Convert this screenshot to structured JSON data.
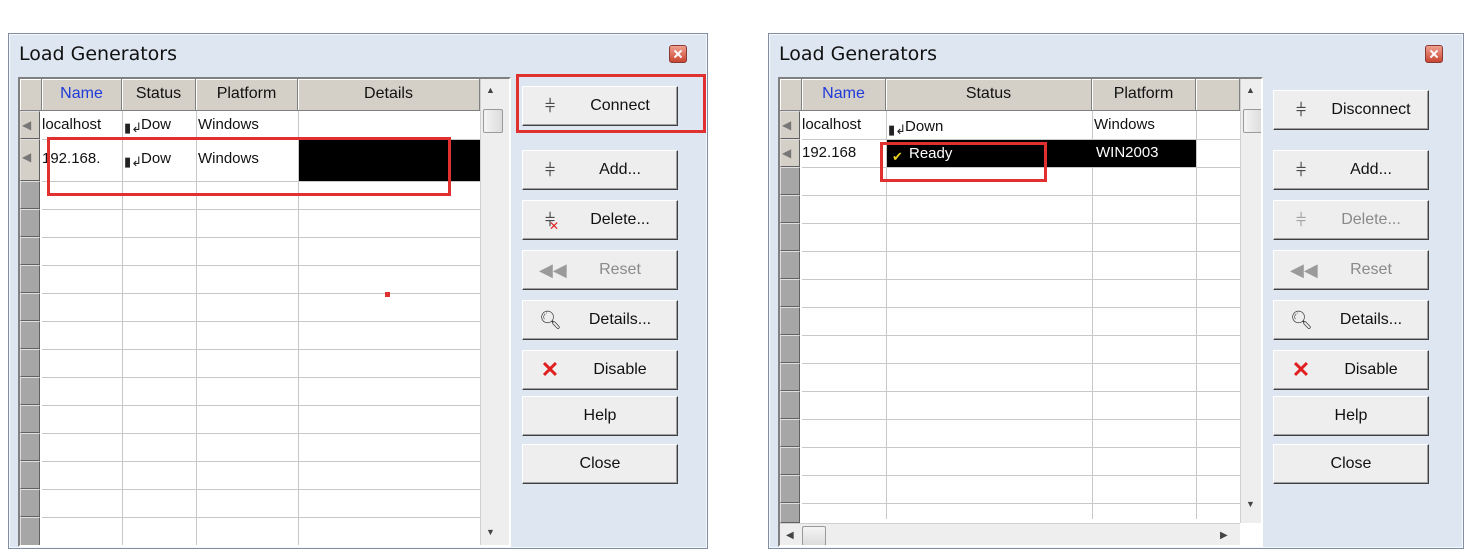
{
  "left_dialog": {
    "title": "Load Generators",
    "columns": [
      "Name",
      "Status",
      "Platform",
      "Details"
    ],
    "rows": [
      {
        "name": "localhost",
        "status": "Dow",
        "platform": "Windows",
        "details": ""
      },
      {
        "name": "192.168.",
        "status": "Dow",
        "platform": "Windows",
        "details": ""
      }
    ],
    "buttons": {
      "connect": "Connect",
      "add": "Add...",
      "delete": "Delete...",
      "reset": "Reset",
      "details": "Details...",
      "disable": "Disable",
      "help": "Help",
      "close": "Close"
    }
  },
  "right_dialog": {
    "title": "Load Generators",
    "columns": [
      "Name",
      "Status",
      "Platform"
    ],
    "rows": [
      {
        "name": "localhost",
        "status": "Down",
        "platform": "Windows"
      },
      {
        "name": "192.168",
        "status": "Ready",
        "platform": "WIN2003"
      }
    ],
    "buttons": {
      "disconnect": "Disconnect",
      "add": "Add...",
      "delete": "Delete...",
      "reset": "Reset",
      "details": "Details...",
      "disable": "Disable",
      "help": "Help",
      "close": "Close"
    }
  },
  "icons": {
    "connect": "network-plug-icon",
    "add": "network-plug-icon",
    "delete": "delete-generator-icon",
    "reset": "rewind-icon",
    "details": "magnifier-document-icon",
    "disable": "red-x-icon",
    "status_down": "machine-down-icon",
    "status_ready": "machine-ready-icon"
  },
  "colors": {
    "highlight_box": "#e03030",
    "name_header": "#1e3ad8",
    "selected_cell": "#000000",
    "dialog_bg": "#dde6f1"
  }
}
